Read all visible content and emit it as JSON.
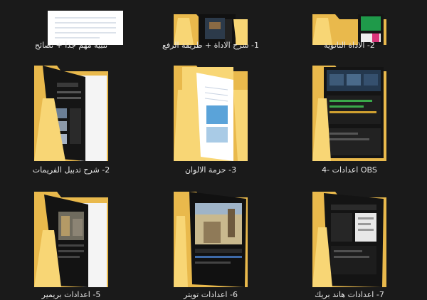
{
  "colors": {
    "background": "#1a1a1a",
    "folder_back": "#e9b94c",
    "folder_front": "#f8d675",
    "label_text": "#e6e6e6"
  },
  "items": [
    {
      "label": "تنبيه مهم جدا + نصائح",
      "preview": "document"
    },
    {
      "label": "1- شرح الاداة + طريقة الرفع",
      "preview": "dark-screens"
    },
    {
      "label": "2- الاداة الثانوية",
      "preview": "green-screens"
    },
    {
      "label": "2- شرح تدبيل الفريمات",
      "preview": "tutorial-pages"
    },
    {
      "label": "3- حزمة الالوان",
      "preview": "documents"
    },
    {
      "label": "OBS اعدادات -4",
      "preview": "obs-screens"
    },
    {
      "label": "5- اعدادات بريمير",
      "preview": "editor-screens"
    },
    {
      "label": "6- اعدادات تويتر",
      "preview": "video-screens"
    },
    {
      "label": "7- اعدادات هاند بريك",
      "preview": "handbrake-screens"
    }
  ]
}
